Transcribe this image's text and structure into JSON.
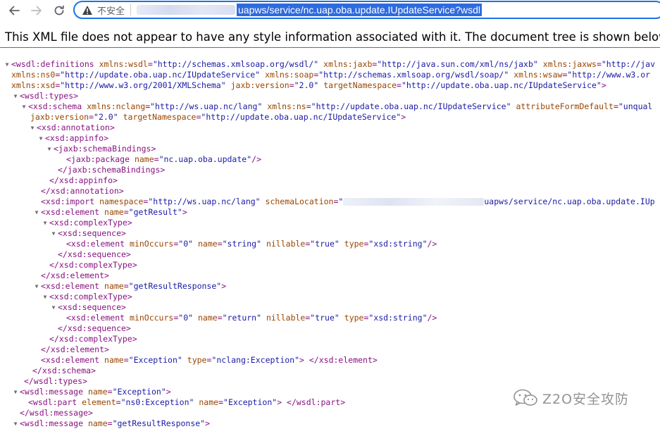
{
  "browser": {
    "back_icon": "arrow-left-icon",
    "forward_icon": "arrow-right-icon",
    "reload_icon": "reload-icon",
    "security_icon": "warning-triangle-icon",
    "security_label": "不安全",
    "url_visible": "uapws/service/nc.uap.oba.update.IUpdateService?wsdl",
    "accent_color": "#1a73e8",
    "selection_color": "#2f6bde"
  },
  "notice": "This XML file does not appear to have any style information associated with it. The document tree is shown below.",
  "xml_lines": [
    {
      "toggle": "▼",
      "segs": [
        [
          "tag",
          "<wsdl:definitions "
        ],
        [
          "an",
          "xmlns:wsdl"
        ],
        [
          "tag",
          "="
        ],
        [
          "av",
          "\"http://schemas.xmlsoap.org/wsdl/\""
        ],
        [
          "tag",
          " "
        ],
        [
          "an",
          "xmlns:jaxb"
        ],
        [
          "tag",
          "="
        ],
        [
          "av",
          "\"http://java.sun.com/xml/ns/jaxb\""
        ],
        [
          "tag",
          " "
        ],
        [
          "an",
          "xmlns:jaxws"
        ],
        [
          "tag",
          "="
        ],
        [
          "av",
          "\"http://jav"
        ]
      ]
    },
    {
      "toggle": "",
      "segs": [
        [
          "an",
          "xmlns:ns0"
        ],
        [
          "tag",
          "="
        ],
        [
          "av",
          "\"http://update.oba.uap.nc/IUpdateService\""
        ],
        [
          "tag",
          " "
        ],
        [
          "an",
          "xmlns:soap"
        ],
        [
          "tag",
          "="
        ],
        [
          "av",
          "\"http://schemas.xmlsoap.org/wsdl/soap/\""
        ],
        [
          "tag",
          " "
        ],
        [
          "an",
          "xmlns:wsaw"
        ],
        [
          "tag",
          "="
        ],
        [
          "av",
          "\"http://www.w3.or"
        ]
      ]
    },
    {
      "toggle": "",
      "segs": [
        [
          "an",
          "xmlns:xsd"
        ],
        [
          "tag",
          "="
        ],
        [
          "av",
          "\"http://www.w3.org/2001/XMLSchema\""
        ],
        [
          "tag",
          " "
        ],
        [
          "an",
          "jaxb:version"
        ],
        [
          "tag",
          "="
        ],
        [
          "av",
          "\"2.0\""
        ],
        [
          "tag",
          " "
        ],
        [
          "an",
          "targetNamespace"
        ],
        [
          "tag",
          "="
        ],
        [
          "av",
          "\"http://update.oba.uap.nc/IUpdateService\""
        ],
        [
          "tag",
          ">"
        ]
      ]
    },
    {
      "toggle": "▼",
      "segs": [
        [
          "tag",
          "<wsdl:types>"
        ]
      ]
    },
    {
      "toggle": "▼",
      "segs": [
        [
          "tag",
          "<xsd:schema "
        ],
        [
          "an",
          "xmlns:nclang"
        ],
        [
          "tag",
          "="
        ],
        [
          "av",
          "\"http://ws.uap.nc/lang\""
        ],
        [
          "tag",
          " "
        ],
        [
          "an",
          "xmlns:ns"
        ],
        [
          "tag",
          "="
        ],
        [
          "av",
          "\"http://update.oba.uap.nc/IUpdateService\""
        ],
        [
          "tag",
          " "
        ],
        [
          "an",
          "attributeFormDefault"
        ],
        [
          "tag",
          "="
        ],
        [
          "av",
          "\"unqual"
        ]
      ]
    },
    {
      "toggle": "",
      "segs": [
        [
          "an",
          "jaxb:version"
        ],
        [
          "tag",
          "="
        ],
        [
          "av",
          "\"2.0\""
        ],
        [
          "tag",
          " "
        ],
        [
          "an",
          "targetNamespace"
        ],
        [
          "tag",
          "="
        ],
        [
          "av",
          "\"http://update.oba.uap.nc/IUpdateService\""
        ],
        [
          "tag",
          ">"
        ]
      ]
    },
    {
      "toggle": "▼",
      "segs": [
        [
          "tag",
          "<xsd:annotation>"
        ]
      ]
    },
    {
      "toggle": "▼",
      "segs": [
        [
          "tag",
          "<xsd:appinfo>"
        ]
      ]
    },
    {
      "toggle": "▼",
      "segs": [
        [
          "tag",
          "<jaxb:schemaBindings>"
        ]
      ]
    },
    {
      "toggle": "",
      "segs": [
        [
          "tag",
          "<jaxb:package "
        ],
        [
          "an",
          "name"
        ],
        [
          "tag",
          "="
        ],
        [
          "av",
          "\"nc.uap.oba.update\""
        ],
        [
          "tag",
          "/>"
        ]
      ]
    },
    {
      "toggle": "",
      "segs": [
        [
          "tag",
          "</jaxb:schemaBindings>"
        ]
      ]
    },
    {
      "toggle": "",
      "segs": [
        [
          "tag",
          "</xsd:appinfo>"
        ]
      ]
    },
    {
      "toggle": "",
      "segs": [
        [
          "tag",
          "</xsd:annotation>"
        ]
      ]
    },
    {
      "toggle": "",
      "segs": [
        [
          "tag",
          "<xsd:import "
        ],
        [
          "an",
          "namespace"
        ],
        [
          "tag",
          "="
        ],
        [
          "av",
          "\"http://ws.uap.nc/lang\""
        ],
        [
          "tag",
          " "
        ],
        [
          "an",
          "schemaLocation"
        ],
        [
          "tag",
          "="
        ],
        [
          "av",
          "\""
        ],
        [
          "blur",
          ""
        ],
        [
          "av",
          "uapws/service/nc.uap.oba.update.IUp"
        ]
      ]
    },
    {
      "toggle": "▼",
      "segs": [
        [
          "tag",
          "<xsd:element "
        ],
        [
          "an",
          "name"
        ],
        [
          "tag",
          "="
        ],
        [
          "av",
          "\"getResult\""
        ],
        [
          "tag",
          ">"
        ]
      ]
    },
    {
      "toggle": "▼",
      "segs": [
        [
          "tag",
          "<xsd:complexType>"
        ]
      ]
    },
    {
      "toggle": "▼",
      "segs": [
        [
          "tag",
          "<xsd:sequence>"
        ]
      ]
    },
    {
      "toggle": "",
      "segs": [
        [
          "tag",
          "<xsd:element "
        ],
        [
          "an",
          "minOccurs"
        ],
        [
          "tag",
          "="
        ],
        [
          "av",
          "\"0\""
        ],
        [
          "tag",
          " "
        ],
        [
          "an",
          "name"
        ],
        [
          "tag",
          "="
        ],
        [
          "av",
          "\"string\""
        ],
        [
          "tag",
          " "
        ],
        [
          "an",
          "nillable"
        ],
        [
          "tag",
          "="
        ],
        [
          "av",
          "\"true\""
        ],
        [
          "tag",
          " "
        ],
        [
          "an",
          "type"
        ],
        [
          "tag",
          "="
        ],
        [
          "av",
          "\"xsd:string\""
        ],
        [
          "tag",
          "/>"
        ]
      ]
    },
    {
      "toggle": "",
      "segs": [
        [
          "tag",
          "</xsd:sequence>"
        ]
      ]
    },
    {
      "toggle": "",
      "segs": [
        [
          "tag",
          "</xsd:complexType>"
        ]
      ]
    },
    {
      "toggle": "",
      "segs": [
        [
          "tag",
          "</xsd:element>"
        ]
      ]
    },
    {
      "toggle": "▼",
      "segs": [
        [
          "tag",
          "<xsd:element "
        ],
        [
          "an",
          "name"
        ],
        [
          "tag",
          "="
        ],
        [
          "av",
          "\"getResultResponse\""
        ],
        [
          "tag",
          ">"
        ]
      ]
    },
    {
      "toggle": "▼",
      "segs": [
        [
          "tag",
          "<xsd:complexType>"
        ]
      ]
    },
    {
      "toggle": "▼",
      "segs": [
        [
          "tag",
          "<xsd:sequence>"
        ]
      ]
    },
    {
      "toggle": "",
      "segs": [
        [
          "tag",
          "<xsd:element "
        ],
        [
          "an",
          "minOccurs"
        ],
        [
          "tag",
          "="
        ],
        [
          "av",
          "\"0\""
        ],
        [
          "tag",
          " "
        ],
        [
          "an",
          "name"
        ],
        [
          "tag",
          "="
        ],
        [
          "av",
          "\"return\""
        ],
        [
          "tag",
          " "
        ],
        [
          "an",
          "nillable"
        ],
        [
          "tag",
          "="
        ],
        [
          "av",
          "\"true\""
        ],
        [
          "tag",
          " "
        ],
        [
          "an",
          "type"
        ],
        [
          "tag",
          "="
        ],
        [
          "av",
          "\"xsd:string\""
        ],
        [
          "tag",
          "/>"
        ]
      ]
    },
    {
      "toggle": "",
      "segs": [
        [
          "tag",
          "</xsd:sequence>"
        ]
      ]
    },
    {
      "toggle": "",
      "segs": [
        [
          "tag",
          "</xsd:complexType>"
        ]
      ]
    },
    {
      "toggle": "",
      "segs": [
        [
          "tag",
          "</xsd:element>"
        ]
      ]
    },
    {
      "toggle": "",
      "segs": [
        [
          "tag",
          "<xsd:element "
        ],
        [
          "an",
          "name"
        ],
        [
          "tag",
          "="
        ],
        [
          "av",
          "\"Exception\""
        ],
        [
          "tag",
          " "
        ],
        [
          "an",
          "type"
        ],
        [
          "tag",
          "="
        ],
        [
          "av",
          "\"nclang:Exception\""
        ],
        [
          "tag",
          "> </xsd:element>"
        ]
      ]
    },
    {
      "toggle": "",
      "segs": [
        [
          "tag",
          "</xsd:schema>"
        ]
      ]
    },
    {
      "toggle": "",
      "segs": [
        [
          "tag",
          "</wsdl:types>"
        ]
      ]
    },
    {
      "toggle": "▼",
      "segs": [
        [
          "tag",
          "<wsdl:message "
        ],
        [
          "an",
          "name"
        ],
        [
          "tag",
          "="
        ],
        [
          "av",
          "\"Exception\""
        ],
        [
          "tag",
          ">"
        ]
      ]
    },
    {
      "toggle": "",
      "segs": [
        [
          "tag",
          "<wsdl:part "
        ],
        [
          "an",
          "element"
        ],
        [
          "tag",
          "="
        ],
        [
          "av",
          "\"ns0:Exception\""
        ],
        [
          "tag",
          " "
        ],
        [
          "an",
          "name"
        ],
        [
          "tag",
          "="
        ],
        [
          "av",
          "\"Exception\""
        ],
        [
          "tag",
          "> </wsdl:part>"
        ]
      ]
    },
    {
      "toggle": "",
      "segs": [
        [
          "tag",
          "</wsdl:message>"
        ]
      ]
    },
    {
      "toggle": "▼",
      "segs": [
        [
          "tag",
          "<wsdl:message "
        ],
        [
          "an",
          "name"
        ],
        [
          "tag",
          "="
        ],
        [
          "av",
          "\"getResultResponse\""
        ],
        [
          "tag",
          ">"
        ]
      ]
    }
  ],
  "watermark": {
    "icon": "wechat-icon",
    "text": "Z2O安全攻防"
  }
}
